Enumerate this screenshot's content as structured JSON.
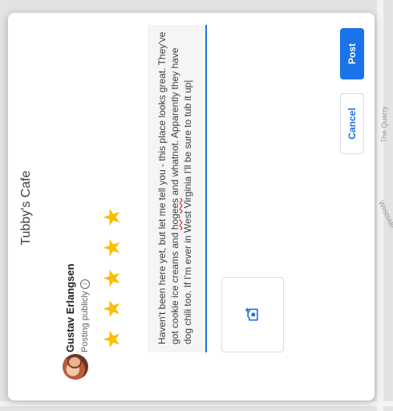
{
  "map": {
    "labels": [
      "The Quarry",
      "Westside"
    ]
  },
  "dialog": {
    "title": "Tubby's Cafe",
    "user_name": "Gustav Erlangsen",
    "posting_label": "Posting publicly",
    "info_icon_glyph": "i",
    "rating": {
      "value": 5,
      "max": 5,
      "star_glyph": "★"
    },
    "review": {
      "text_before": "Haven't been here yet, but let me tell you - this place looks great. They've got cookie ice creams and ",
      "misspelled_word": "hogees",
      "text_after": " and whatnot. Apparently they have dog chili too. If I'm ever in West Virginia I'll be sure to tub it up|"
    },
    "photo_button_icon": "add-photo-icon",
    "cancel_label": "Cancel",
    "post_label": "Post"
  },
  "colors": {
    "accent": "#1a73e8",
    "star": "#fbbc04",
    "title_text": "#3c4043"
  }
}
